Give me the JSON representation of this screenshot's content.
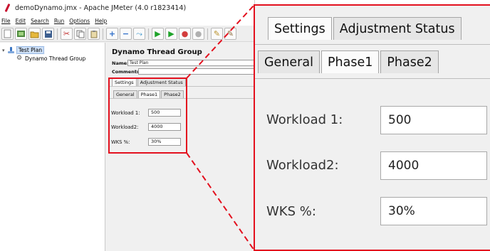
{
  "window": {
    "title": "demoDynamo.jmx - Apache JMeter (4.0 r1823414)"
  },
  "menu": [
    "File",
    "Edit",
    "Search",
    "Run",
    "Options",
    "Help"
  ],
  "toolbar": {
    "icons": [
      "new-icon",
      "templates-icon",
      "open-icon",
      "save-icon",
      "cut-icon",
      "copy-icon",
      "paste-icon",
      "expand-icon",
      "collapse-icon",
      "toggle-icon",
      "start-icon",
      "start-no-pause-icon",
      "stop-icon",
      "shutdown-icon",
      "clear-icon",
      "clear-all-icon"
    ]
  },
  "tree": {
    "root": "Test Plan",
    "child": "Dynamo Thread Group"
  },
  "panel": {
    "title": "Dynamo Thread Group",
    "name_label": "Name:",
    "name_value": "Test Plan",
    "comments_label": "Comments:"
  },
  "tabs": {
    "top": [
      "Settings",
      "Adjustment Status"
    ],
    "sub": [
      "General",
      "Phase1",
      "Phase2"
    ],
    "selected_sub": "Phase1"
  },
  "fields": [
    {
      "label": "Workload 1:",
      "value": "500"
    },
    {
      "label": "Workload2:",
      "value": "4000"
    },
    {
      "label": "WKS %:",
      "value": "30%"
    }
  ],
  "colors": {
    "highlight": "#e3101e",
    "panel_bg": "#f0f0f0"
  }
}
